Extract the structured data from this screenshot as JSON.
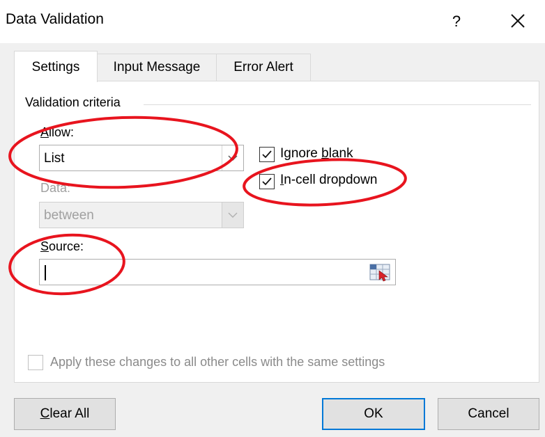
{
  "window": {
    "title": "Data Validation",
    "help_label": "?",
    "close_icon": "close-icon"
  },
  "tabs": [
    {
      "label": "Settings",
      "selected": true
    },
    {
      "label": "Input Message",
      "selected": false
    },
    {
      "label": "Error Alert",
      "selected": false
    }
  ],
  "criteria": {
    "group_title": "Validation criteria",
    "allow": {
      "prefix": "A",
      "rest": "llow:",
      "value": "List"
    },
    "data": {
      "label": "Data:",
      "value": "between",
      "disabled": true
    },
    "ignore_blank": {
      "prefix": "Ignore ",
      "underline": "b",
      "rest": "lank",
      "checked": true
    },
    "in_cell_dropdown": {
      "prefix": "",
      "underline": "I",
      "rest": "n-cell dropdown",
      "checked": true
    },
    "source": {
      "prefix": "S",
      "rest": "ource:",
      "value": ""
    }
  },
  "apply": {
    "label": "Apply these changes to all other cells with the same settings",
    "checked": false,
    "disabled": true
  },
  "buttons": {
    "clear_all": {
      "underline": "C",
      "rest": "lear All"
    },
    "ok": "OK",
    "cancel": "Cancel"
  },
  "colors": {
    "annotation": "#e8141e",
    "focus_border": "#0078d7",
    "dialog_bg": "#f0f0f0"
  }
}
